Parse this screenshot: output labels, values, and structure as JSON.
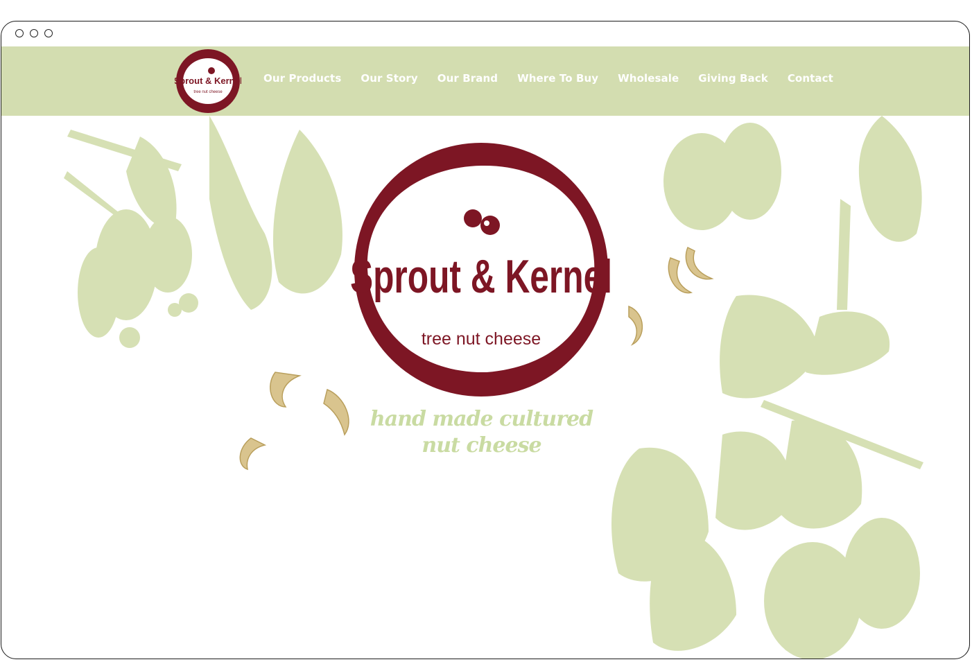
{
  "brand": {
    "name": "Sprout & Kernel",
    "subtitle": "tree nut cheese"
  },
  "nav": {
    "items": [
      {
        "label": "Our Products"
      },
      {
        "label": "Our Story"
      },
      {
        "label": "Our Brand"
      },
      {
        "label": "Where To Buy"
      },
      {
        "label": "Wholesale"
      },
      {
        "label": "Giving Back"
      },
      {
        "label": "Contact"
      }
    ]
  },
  "hero": {
    "tagline_line1": "hand made cultured",
    "tagline_line2": "nut cheese"
  },
  "colors": {
    "nav_bg": "#d3ddb0",
    "brand_red": "#7d1624",
    "leaf_green": "#d6e0b4",
    "cashew": "#d9c48e"
  }
}
